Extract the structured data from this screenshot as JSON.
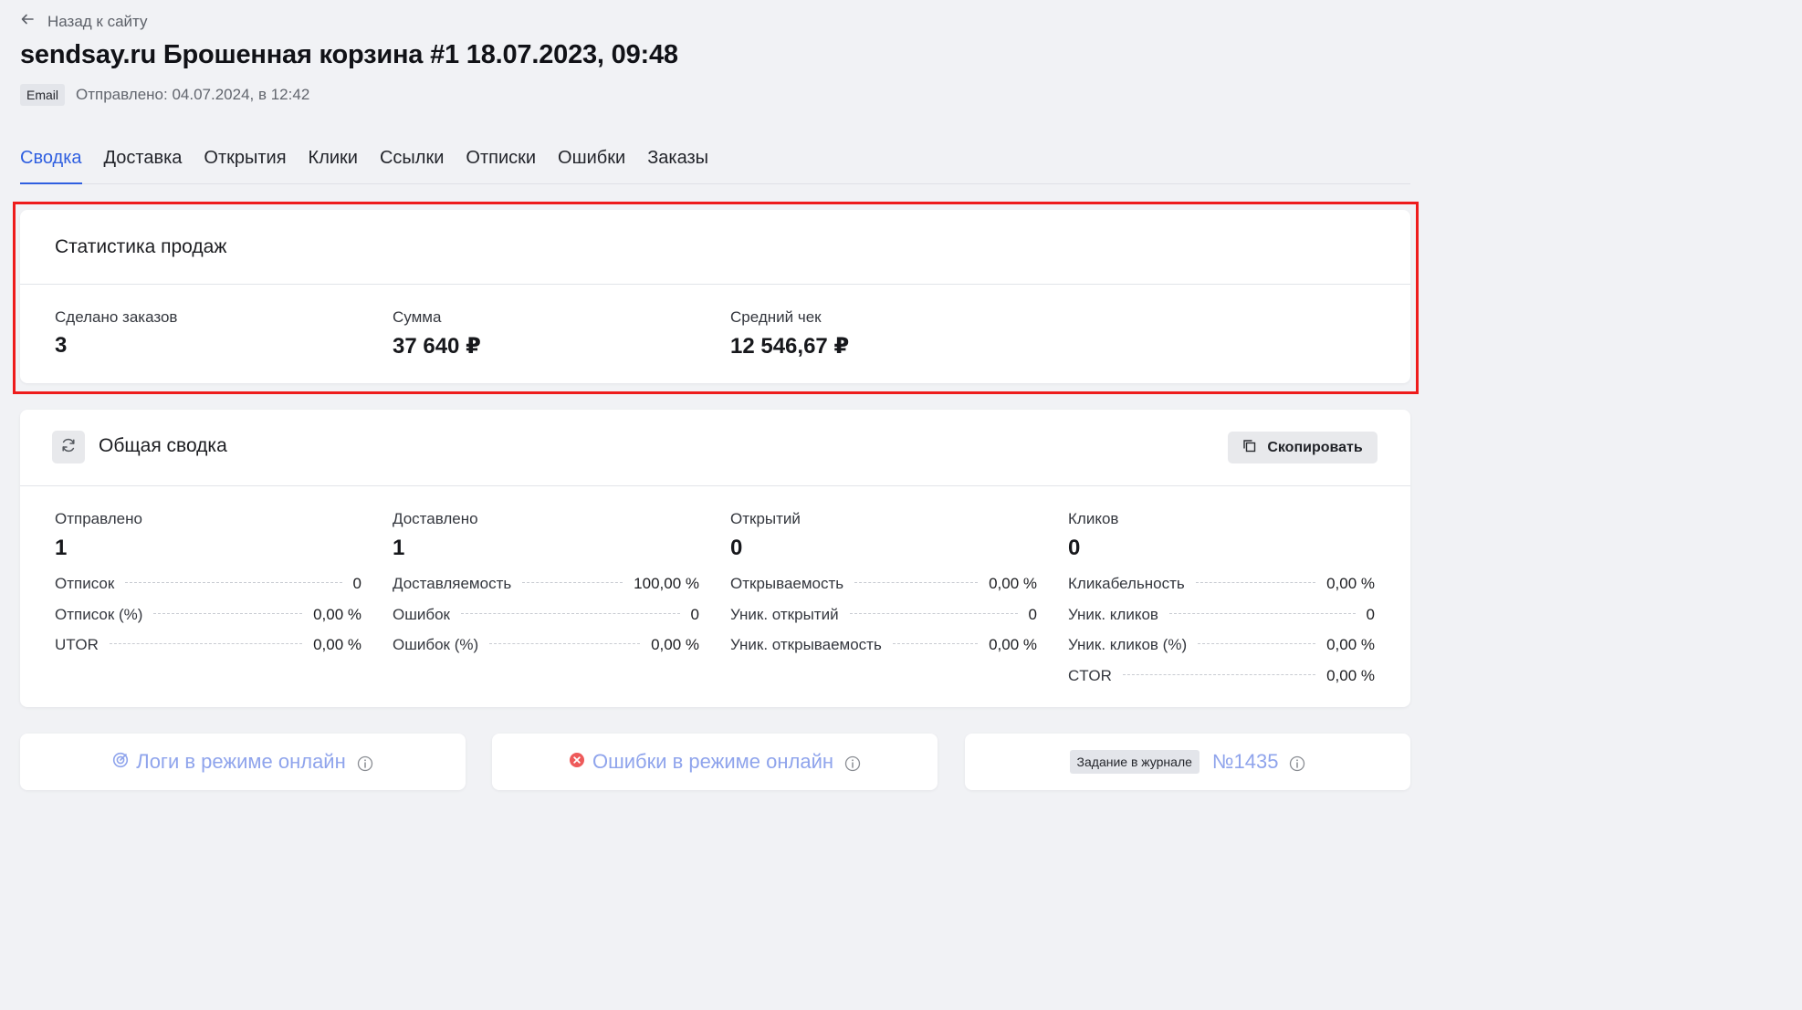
{
  "nav": {
    "back_label": "Назад к сайту"
  },
  "header": {
    "title": "sendsay.ru Брошенная корзина #1 18.07.2023, 09:48",
    "channel_badge": "Email",
    "sent_info": "Отправлено: 04.07.2024, в 12:42"
  },
  "tabs": [
    {
      "label": "Сводка",
      "active": true
    },
    {
      "label": "Доставка"
    },
    {
      "label": "Открытия"
    },
    {
      "label": "Клики"
    },
    {
      "label": "Ссылки"
    },
    {
      "label": "Отписки"
    },
    {
      "label": "Ошибки"
    },
    {
      "label": "Заказы"
    }
  ],
  "sales": {
    "title": "Статистика продаж",
    "kpis": [
      {
        "label": "Сделано заказов",
        "value": "3"
      },
      {
        "label": "Сумма",
        "value": "37 640 ₽"
      },
      {
        "label": "Средний чек",
        "value": "12 546,67 ₽"
      }
    ]
  },
  "summary": {
    "title": "Общая сводка",
    "copy_label": "Скопировать",
    "columns": [
      {
        "label": "Отправлено",
        "value": "1",
        "rows": [
          {
            "label": "Отписок",
            "value": "0"
          },
          {
            "label": "Отписок (%)",
            "value": "0,00 %"
          },
          {
            "label": "UTOR",
            "value": "0,00 %"
          }
        ]
      },
      {
        "label": "Доставлено",
        "value": "1",
        "rows": [
          {
            "label": "Доставляемость",
            "value": "100,00 %"
          },
          {
            "label": "Ошибок",
            "value": "0"
          },
          {
            "label": "Ошибок (%)",
            "value": "0,00 %"
          }
        ]
      },
      {
        "label": "Открытий",
        "value": "0",
        "rows": [
          {
            "label": "Открываемость",
            "value": "0,00 %"
          },
          {
            "label": "Уник. открытий",
            "value": "0"
          },
          {
            "label": "Уник. открываемость",
            "value": "0,00 %"
          }
        ]
      },
      {
        "label": "Кликов",
        "value": "0",
        "rows": [
          {
            "label": "Кликабельность",
            "value": "0,00 %"
          },
          {
            "label": "Уник. кликов",
            "value": "0"
          },
          {
            "label": "Уник. кликов (%)",
            "value": "0,00 %"
          },
          {
            "label": "CTOR",
            "value": "0,00 %"
          }
        ]
      }
    ]
  },
  "bottom": {
    "logs_label": "Логи в режиме онлайн",
    "errors_label": "Ошибки в режиме онлайн",
    "task_badge": "Задание в журнале",
    "task_number": "№1435"
  },
  "colors": {
    "accent": "#2f5fe0",
    "link_muted": "#8fa4ec",
    "error_red": "#ee5a5a",
    "highlight": "#ee1c1c"
  }
}
